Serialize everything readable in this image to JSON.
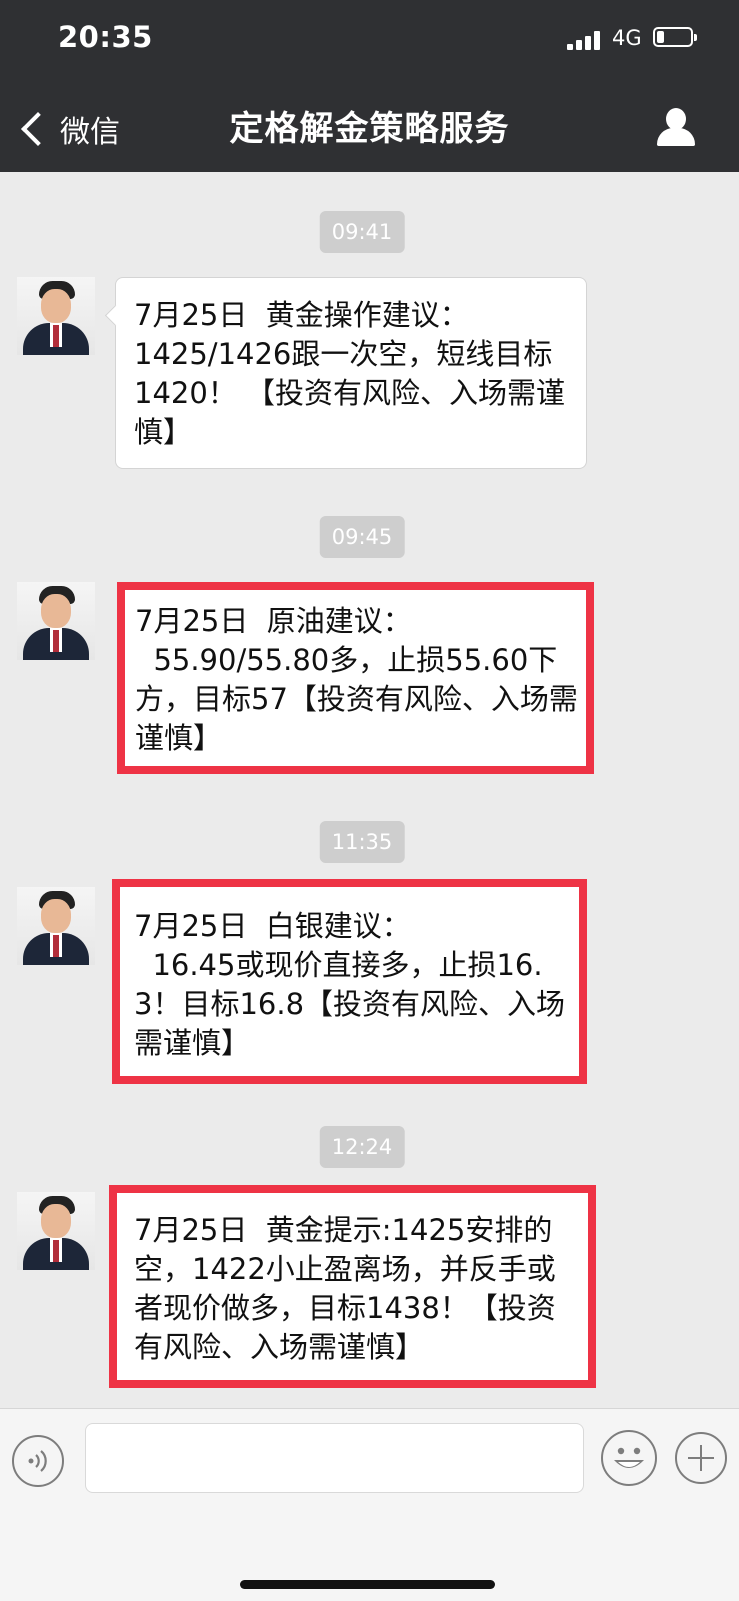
{
  "status_bar": {
    "time": "20:35",
    "network": "4G"
  },
  "nav": {
    "back_label": "微信",
    "title": "定格解金策略服务"
  },
  "messages": [
    {
      "time": "09:41",
      "text": "7月25日  黄金操作建议：\n1425/1426跟一次空，短线目标1420！ 【投资有风险、入场需谨慎】"
    },
    {
      "time": "09:45",
      "text": "7月25日  原油建议：\n  55.90/55.80多，止损55.60下方，目标57【投资有风险、入场需谨慎】"
    },
    {
      "time": "11:35",
      "text": "7月25日  白银建议：\n  16.45或现价直接多，止损16.3！目标16.8【投资有风险、入场需谨慎】"
    },
    {
      "time": "12:24",
      "text": "7月25日  黄金提示:1425安排的空，1422小止盈离场，并反手或者现价做多，目标1438！【投资有风险、入场需谨慎】"
    }
  ],
  "input": {
    "placeholder": ""
  },
  "colors": {
    "header": "#2f3033",
    "chat_bg": "#ebebeb",
    "highlight": "#ee3345",
    "time_chip": "#cecece"
  },
  "icons": [
    "back-chevron-icon",
    "profile-icon",
    "avatar",
    "voice-icon",
    "emoji-icon",
    "plus-icon"
  ]
}
